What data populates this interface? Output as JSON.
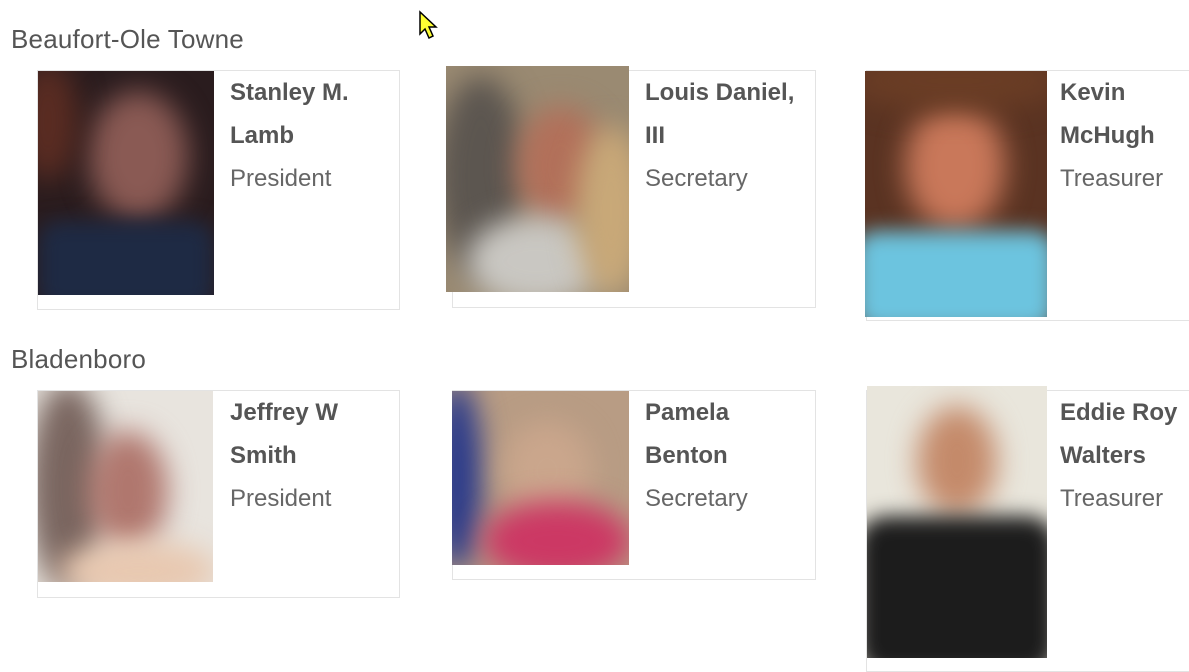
{
  "groups": [
    {
      "title": "Beaufort-Ole Towne",
      "members": [
        {
          "name_line1": "Stanley M.",
          "name_line2": "Lamb",
          "role": "President"
        },
        {
          "name_line1": "Louis Daniel,",
          "name_line2": "III",
          "role": "Secretary"
        },
        {
          "name_line1": "Kevin",
          "name_line2": "McHugh",
          "role": "Treasurer"
        }
      ]
    },
    {
      "title": "Bladenboro",
      "members": [
        {
          "name_line1": "Jeffrey W",
          "name_line2": "Smith",
          "role": "President"
        },
        {
          "name_line1": "Pamela",
          "name_line2": "Benton",
          "role": "Secretary"
        },
        {
          "name_line1": "Eddie Roy",
          "name_line2": "Walters",
          "role": "Treasurer"
        }
      ]
    }
  ],
  "colors": {
    "text": "#555555",
    "border": "#e3e3e3",
    "cursor": "#ffff33"
  },
  "icons": [
    "mouse-cursor-icon"
  ]
}
